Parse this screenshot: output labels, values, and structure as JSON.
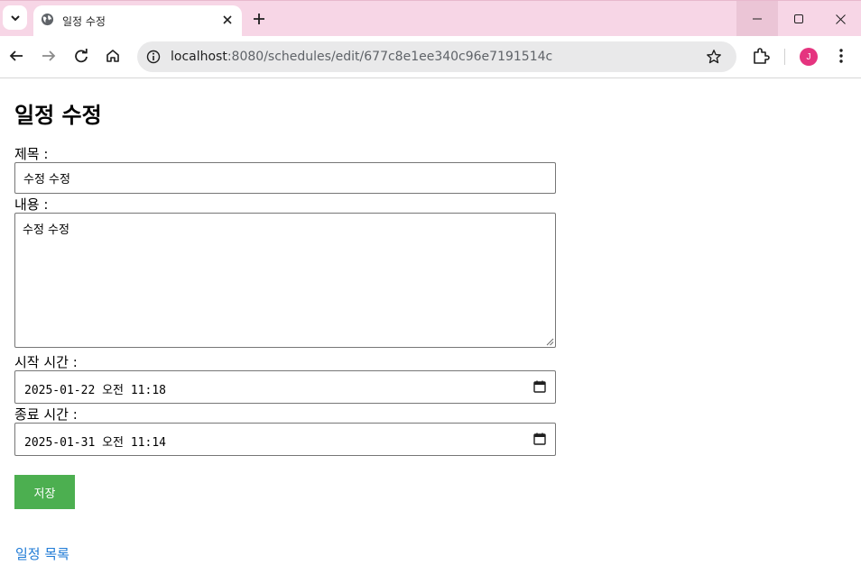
{
  "browser": {
    "tab_title": "일정 수정",
    "url_host": "localhost",
    "url_rest": ":8080/schedules/edit/677c8e1ee340c96e7191514c",
    "avatar_initial": "J",
    "icons": [
      "tab-search-icon",
      "globe-icon",
      "close-icon",
      "plus-icon",
      "minimize-icon",
      "maximize-icon",
      "window-close-icon",
      "back-arrow-icon",
      "forward-arrow-icon",
      "reload-icon",
      "home-icon",
      "info-icon",
      "star-icon",
      "extensions-icon",
      "kebab-menu-icon"
    ]
  },
  "page": {
    "title": "일정 수정",
    "title_field": {
      "label": "제목 :",
      "value": "수정 수정"
    },
    "content_field": {
      "label": "내용 :",
      "value": "수정 수정"
    },
    "start_field": {
      "label": "시작 시간 :",
      "value": "2025-01-22 오전 11:18"
    },
    "end_field": {
      "label": "종료 시간 :",
      "value": "2025-01-31 오전 11:14"
    },
    "save_button": "저장",
    "list_link": "일정 목록",
    "colors": {
      "save_button": "#4caf50",
      "link": "#1e7ad6",
      "tabstrip": "#f7d6e6"
    }
  }
}
